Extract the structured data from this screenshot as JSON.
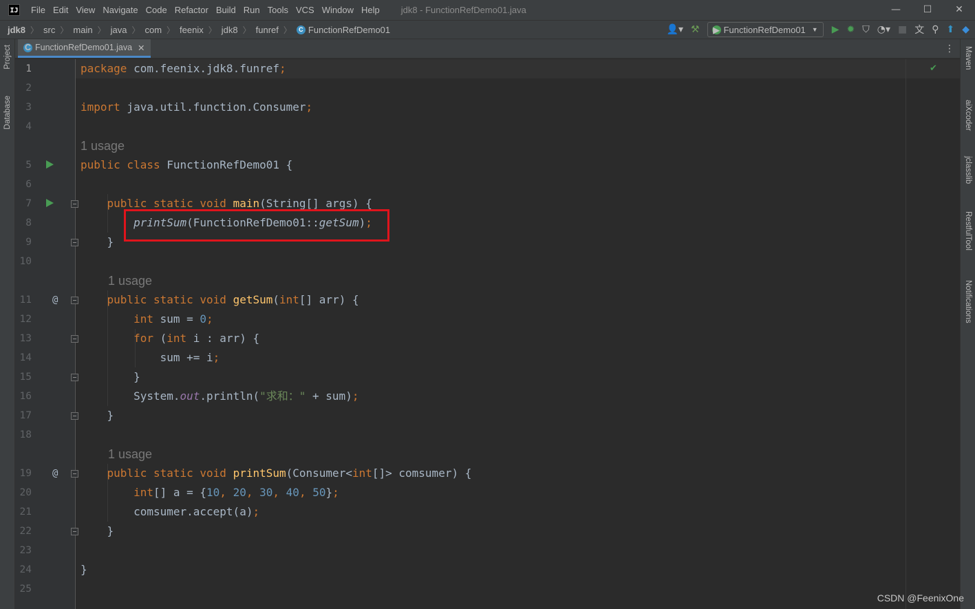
{
  "window": {
    "app_icon_text": "IJ",
    "title": "jdk8 - FunctionRefDemo01.java",
    "menu": [
      "File",
      "Edit",
      "View",
      "Navigate",
      "Code",
      "Refactor",
      "Build",
      "Run",
      "Tools",
      "VCS",
      "Window",
      "Help"
    ],
    "controls": {
      "minimize": "—",
      "maximize": "☐",
      "close": "✕"
    }
  },
  "breadcrumb": [
    "jdk8",
    "src",
    "main",
    "java",
    "com",
    "feenix",
    "jdk8",
    "funref",
    "FunctionRefDemo01"
  ],
  "toolbar": {
    "run_config": "FunctionRefDemo01",
    "icons": [
      "user-icon",
      "build-hammer-icon",
      "run-icon",
      "debug-icon",
      "coverage-icon",
      "profile-icon",
      "stop-icon",
      "translate-icon",
      "search-icon",
      "update-icon",
      "plugin-icon"
    ]
  },
  "tabs": [
    {
      "label": "FunctionRefDemo01.java",
      "active": true
    }
  ],
  "left_tool_windows": [
    "Project",
    "Database"
  ],
  "right_tool_windows": [
    "Maven",
    "aiXcoder",
    "jclasslib",
    "RestfulTool",
    "Notifications"
  ],
  "editor": {
    "inlay_hint": "1 usage",
    "line_numbers": [
      "1",
      "2",
      "3",
      "4",
      "5",
      "6",
      "7",
      "8",
      "9",
      "10",
      "11",
      "12",
      "13",
      "14",
      "15",
      "16",
      "17",
      "18",
      "19",
      "20",
      "21",
      "22",
      "23",
      "24",
      "25"
    ],
    "lines": [
      "package com.feenix.jdk8.funref;",
      "",
      "import java.util.function.Consumer;",
      "",
      "public class FunctionRefDemo01 {",
      "",
      "    public static void main(String[] args) {",
      "        printSum(FunctionRefDemo01::getSum);",
      "    }",
      "",
      "    public static void getSum(int[] arr) {",
      "        int sum = 0;",
      "        for (int i : arr) {",
      "            sum += i;",
      "        }",
      "        System.out.println(\"求和：\" + sum);",
      "    }",
      "",
      "    public static void printSum(Consumer<int[]> comsumer) {",
      "        int[] a = {10, 20, 30, 40, 50};",
      "        comsumer.accept(a);",
      "    }",
      "",
      "}",
      ""
    ],
    "highlighted_line": 8
  },
  "watermark": "CSDN @FeenixOne"
}
